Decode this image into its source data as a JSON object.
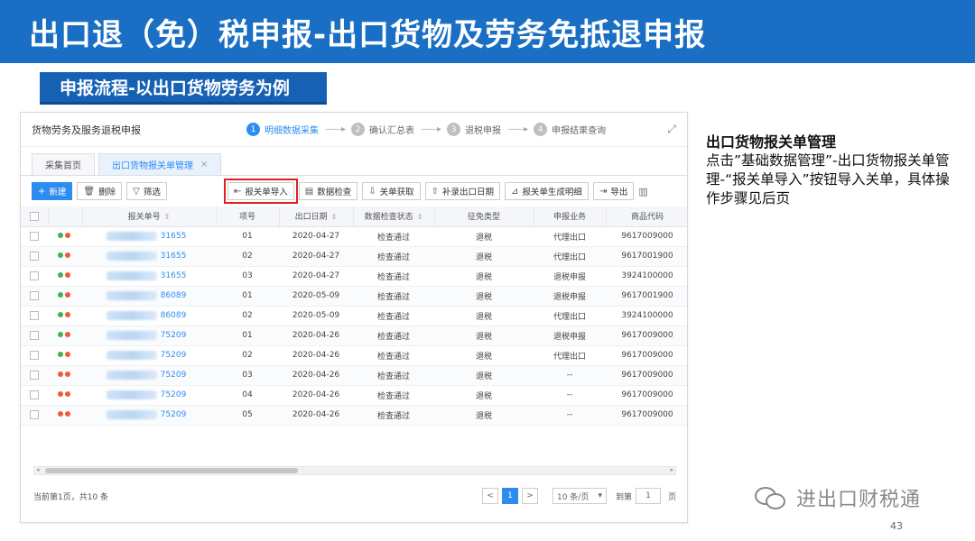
{
  "banner": {
    "title": "出口退（免）税申报-出口货物及劳务免抵退申报"
  },
  "subhead": {
    "title": "申报流程-以出口货物劳务为例"
  },
  "app": {
    "title": "货物劳务及服务退税申报",
    "steps": [
      {
        "num": "1",
        "label": "明细数据采集"
      },
      {
        "num": "2",
        "label": "确认汇总表"
      },
      {
        "num": "3",
        "label": "退税申报"
      },
      {
        "num": "4",
        "label": "申报结果查询"
      }
    ],
    "tabs": [
      {
        "label": "采集首页"
      },
      {
        "label": "出口货物报关单管理",
        "close": "×"
      }
    ],
    "toolbar": {
      "new": "新建",
      "delete": "删除",
      "filter": "筛选",
      "import": "报关单导入",
      "check": "数据检查",
      "fetch": "关单获取",
      "supplement": "补录出口日期",
      "generate": "报关单生成明细",
      "export": "导出"
    },
    "columns": [
      "报关单号",
      "项号",
      "出口日期",
      "数据检查状态",
      "征免类型",
      "申报业务",
      "商品代码"
    ],
    "rows": [
      {
        "dot": "#3fb34f",
        "no": "31655",
        "item": "01",
        "date": "2020-04-27",
        "status": "检查通过",
        "type": "退税",
        "biz": "代理出口",
        "code": "9617009000"
      },
      {
        "dot": "#3fb34f",
        "no": "31655",
        "item": "02",
        "date": "2020-04-27",
        "status": "检查通过",
        "type": "退税",
        "biz": "代理出口",
        "code": "9617001900"
      },
      {
        "dot": "#3fb34f",
        "no": "31655",
        "item": "03",
        "date": "2020-04-27",
        "status": "检查通过",
        "type": "退税",
        "biz": "退税申报",
        "code": "3924100000"
      },
      {
        "dot": "#3fb34f",
        "no": "86089",
        "item": "01",
        "date": "2020-05-09",
        "status": "检查通过",
        "type": "退税",
        "biz": "退税申报",
        "code": "9617001900"
      },
      {
        "dot": "#3fb34f",
        "no": "86089",
        "item": "02",
        "date": "2020-05-09",
        "status": "检查通过",
        "type": "退税",
        "biz": "代理出口",
        "code": "3924100000"
      },
      {
        "dot": "#3fb34f",
        "no": "75209",
        "item": "01",
        "date": "2020-04-26",
        "status": "检查通过",
        "type": "退税",
        "biz": "退税申报",
        "code": "9617009000"
      },
      {
        "dot": "#3fb34f",
        "no": "75209",
        "item": "02",
        "date": "2020-04-26",
        "status": "检查通过",
        "type": "退税",
        "biz": "代理出口",
        "code": "9617009000"
      },
      {
        "dot": "#f05a3c",
        "no": "75209",
        "item": "03",
        "date": "2020-04-26",
        "status": "检查通过",
        "type": "退税",
        "biz": "--",
        "code": "9617009000"
      },
      {
        "dot": "#f05a3c",
        "no": "75209",
        "item": "04",
        "date": "2020-04-26",
        "status": "检查通过",
        "type": "退税",
        "biz": "--",
        "code": "9617009000"
      },
      {
        "dot": "#f05a3c",
        "no": "75209",
        "item": "05",
        "date": "2020-04-26",
        "status": "检查通过",
        "type": "退税",
        "biz": "--",
        "code": "9617009000"
      }
    ],
    "pager": {
      "info": "当前第1页，共10 条",
      "prev": "<",
      "current": "1",
      "next": ">",
      "per_page": "10 条/页",
      "goto_label": "到第",
      "goto_value": "1",
      "goto_unit": "页"
    }
  },
  "side": {
    "heading": "出口货物报关单管理",
    "body": "点击”基础数据管理”-出口货物报关单管理-“报关单导入”按钮导入关单，具体操作步骤见后页"
  },
  "brand": {
    "name": "进出口财税通"
  },
  "page_number": "43",
  "colors": {
    "banner": "#1a6fc4",
    "accent": "#2d8cf0",
    "highlight": "#e02020",
    "dot_ok": "#3fb34f",
    "dot_warn": "#f05a3c"
  }
}
